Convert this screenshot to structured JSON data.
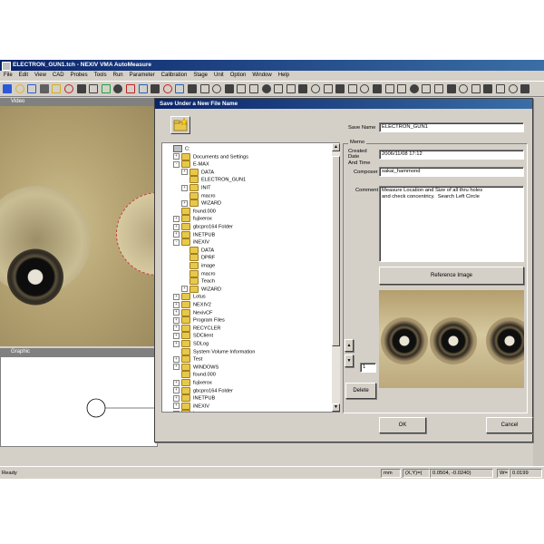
{
  "window": {
    "title": "ELECTRON_GUN1.tch - NEXIV VMA AutoMeasure"
  },
  "menu": [
    "File",
    "Edit",
    "View",
    "CAD",
    "Probes",
    "Tools",
    "Run",
    "Parameter",
    "Calibration",
    "Stage",
    "Unit",
    "Option",
    "Window",
    "Help"
  ],
  "panes": {
    "video": "Video",
    "graphic": "Graphic"
  },
  "dialog": {
    "title": "Save Under a New File Name",
    "tree": [
      {
        "label": "C:",
        "depth": 0,
        "expand": "",
        "kind": "drive"
      },
      {
        "label": "Documents and Settings",
        "depth": 1,
        "expand": "+",
        "kind": "folder"
      },
      {
        "label": "E-MAX",
        "depth": 1,
        "expand": "-",
        "kind": "folder"
      },
      {
        "label": "DATA",
        "depth": 2,
        "expand": "+",
        "kind": "folder"
      },
      {
        "label": "ELECTRON_GUN1",
        "depth": 2,
        "expand": "",
        "kind": "folder"
      },
      {
        "label": "INIT",
        "depth": 2,
        "expand": "+",
        "kind": "folder"
      },
      {
        "label": "macro",
        "depth": 2,
        "expand": "",
        "kind": "folder"
      },
      {
        "label": "WIZARD",
        "depth": 2,
        "expand": "+",
        "kind": "folder"
      },
      {
        "label": "found.000",
        "depth": 1,
        "expand": "",
        "kind": "folder"
      },
      {
        "label": "fujixerox",
        "depth": 1,
        "expand": "+",
        "kind": "folder"
      },
      {
        "label": "gbcpro164 Folder",
        "depth": 1,
        "expand": "+",
        "kind": "folder"
      },
      {
        "label": "INETPUB",
        "depth": 1,
        "expand": "+",
        "kind": "folder"
      },
      {
        "label": "iNEXIV",
        "depth": 1,
        "expand": "-",
        "kind": "folder"
      },
      {
        "label": "DATA",
        "depth": 2,
        "expand": "",
        "kind": "folder"
      },
      {
        "label": "DPRF",
        "depth": 2,
        "expand": "",
        "kind": "folder"
      },
      {
        "label": "image",
        "depth": 2,
        "expand": "",
        "kind": "folder"
      },
      {
        "label": "macro",
        "depth": 2,
        "expand": "",
        "kind": "folder"
      },
      {
        "label": "Teach",
        "depth": 2,
        "expand": "",
        "kind": "folder"
      },
      {
        "label": "WIZARD",
        "depth": 2,
        "expand": "+",
        "kind": "folder"
      },
      {
        "label": "Lotus",
        "depth": 1,
        "expand": "+",
        "kind": "folder"
      },
      {
        "label": "NEXIV2",
        "depth": 1,
        "expand": "+",
        "kind": "folder"
      },
      {
        "label": "NexivCF",
        "depth": 1,
        "expand": "+",
        "kind": "folder"
      },
      {
        "label": "Program Files",
        "depth": 1,
        "expand": "+",
        "kind": "folder"
      },
      {
        "label": "RECYCLER",
        "depth": 1,
        "expand": "+",
        "kind": "folder"
      },
      {
        "label": "SDClient",
        "depth": 1,
        "expand": "+",
        "kind": "folder"
      },
      {
        "label": "SDLog",
        "depth": 1,
        "expand": "+",
        "kind": "folder"
      },
      {
        "label": "System Volume Information",
        "depth": 1,
        "expand": "",
        "kind": "folder"
      },
      {
        "label": "Test",
        "depth": 1,
        "expand": "+",
        "kind": "folder"
      },
      {
        "label": "WINDOWS",
        "depth": 1,
        "expand": "+",
        "kind": "folder"
      },
      {
        "label": "found.000",
        "depth": 1,
        "expand": "",
        "kind": "folder"
      },
      {
        "label": "fujixerox",
        "depth": 1,
        "expand": "+",
        "kind": "folder"
      },
      {
        "label": "gbcpro164 Folder",
        "depth": 1,
        "expand": "+",
        "kind": "folder"
      },
      {
        "label": "INETPUB",
        "depth": 1,
        "expand": "+",
        "kind": "folder"
      },
      {
        "label": "iNEXIV",
        "depth": 1,
        "expand": "+",
        "kind": "folder"
      },
      {
        "label": "Lotus",
        "depth": 1,
        "expand": "+",
        "kind": "folder"
      }
    ],
    "save_name_label": "Save Name",
    "save_name_value": "ELECTRON_GUN1",
    "memo_label": "Memo",
    "created_label": "Created\nDate\nAnd Time",
    "created_value": "2006/11/08 17:12",
    "composer_label": "Composer",
    "composer_value": "sakai_hammond",
    "comment_label": "Comment",
    "comment_value": "Measure Location and Size of all thru holes\nand check concentricy.  Search Left Circle",
    "reference_image_button": "Reference Image",
    "page_number": "1",
    "delete_button": "Delete",
    "ok_button": "OK",
    "cancel_button": "Cancel",
    "scroll_up_glyph": "▲",
    "scroll_down_glyph": "▼"
  },
  "status": {
    "ready": "Ready",
    "unit": "mm",
    "coord_label": "(X,Y)=(",
    "coord_value": "0.0504,  -0.0240)",
    "w_label": "W=",
    "w_value": "0.0199"
  }
}
